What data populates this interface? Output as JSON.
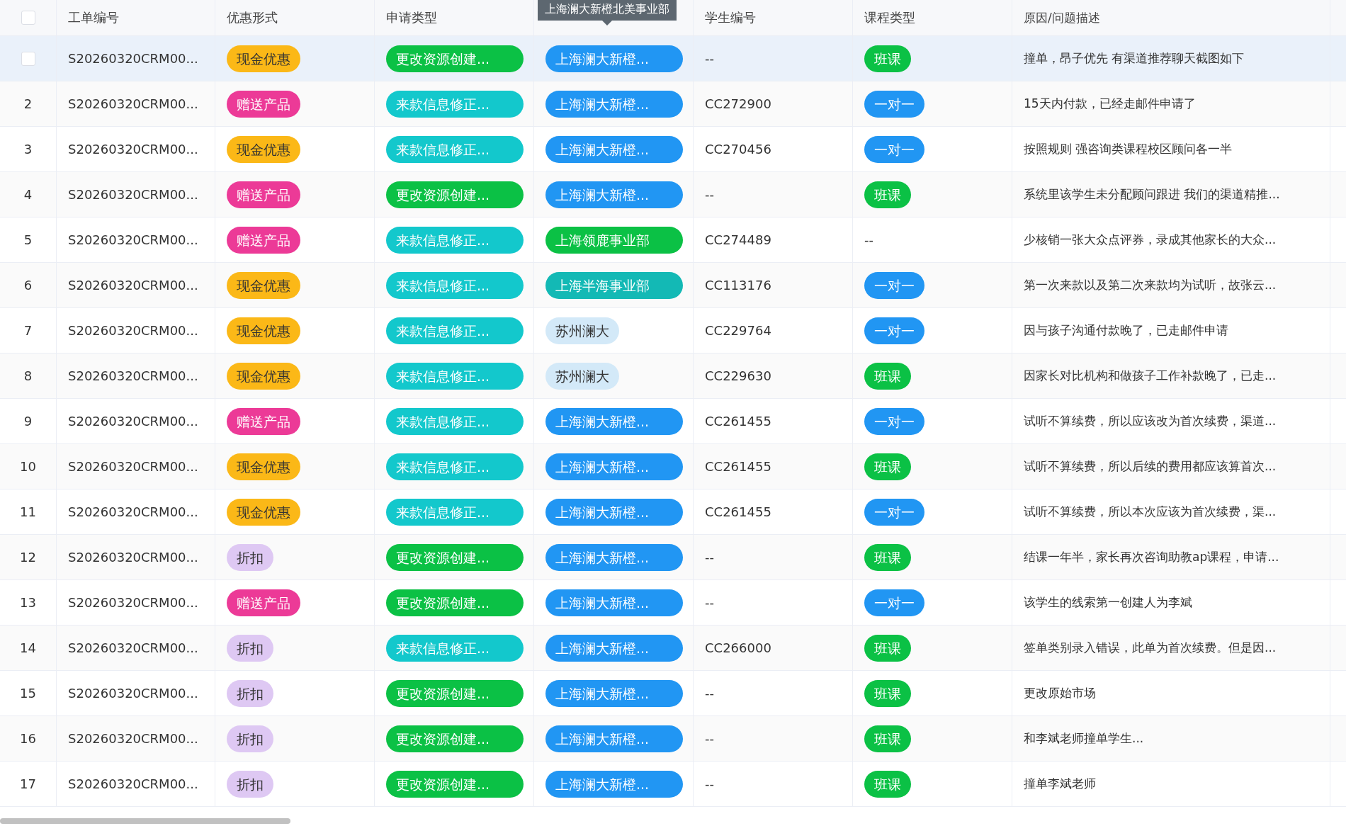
{
  "table": {
    "header_checkbox": {
      "checked": false
    },
    "columns": [
      "工单编号",
      "优惠形式",
      "申请类型",
      "",
      "学生编号",
      "课程类型",
      "原因/问题描述"
    ],
    "rows": [
      {
        "hovered": true,
        "checkbox": {
          "checked": false
        },
        "order_no": "S20260320CRM00...",
        "discount": {
          "text": "现金优惠",
          "color": "#fbb817"
        },
        "request": {
          "text": "更改资源创建...",
          "color": "#0bc145"
        },
        "org": {
          "text": "上海澜大新橙...",
          "color": "#2196f3",
          "tooltip": "上海澜大新橙北美事业部"
        },
        "student_no": "--",
        "course": {
          "text": "班课",
          "color": "#0bc145"
        },
        "reason": "撞单，昂子优先 有渠道推荐聊天截图如下"
      },
      {
        "hovered": false,
        "number": "2",
        "order_no": "S20260320CRM00...",
        "discount": {
          "text": "赠送产品",
          "color": "#ec3a97"
        },
        "request": {
          "text": "来款信息修正...",
          "color": "#13c8cc"
        },
        "org": {
          "text": "上海澜大新橙...",
          "color": "#2196f3"
        },
        "student_no": "CC272900",
        "course": {
          "text": "一对一",
          "color": "#2196f3"
        },
        "reason": "15天内付款，已经走邮件申请了"
      },
      {
        "hovered": false,
        "number": "3",
        "order_no": "S20260320CRM00...",
        "discount": {
          "text": "现金优惠",
          "color": "#fbb817"
        },
        "request": {
          "text": "来款信息修正...",
          "color": "#13c8cc"
        },
        "org": {
          "text": "上海澜大新橙...",
          "color": "#2196f3"
        },
        "student_no": "CC270456",
        "course": {
          "text": "一对一",
          "color": "#2196f3"
        },
        "reason": "按照规则 强咨询类课程校区顾问各一半"
      },
      {
        "hovered": false,
        "number": "4",
        "order_no": "S20260320CRM00...",
        "discount": {
          "text": "赠送产品",
          "color": "#ec3a97"
        },
        "request": {
          "text": "更改资源创建...",
          "color": "#0bc145"
        },
        "org": {
          "text": "上海澜大新橙...",
          "color": "#2196f3"
        },
        "student_no": "--",
        "course": {
          "text": "班课",
          "color": "#0bc145"
        },
        "reason": "系统里该学生未分配顾问跟进 我们的渠道精推..."
      },
      {
        "hovered": false,
        "number": "5",
        "order_no": "S20260320CRM00...",
        "discount": {
          "text": "赠送产品",
          "color": "#ec3a97"
        },
        "request": {
          "text": "来款信息修正...",
          "color": "#13c8cc"
        },
        "org": {
          "text": "上海领鹿事业部",
          "color": "#0bc145"
        },
        "student_no": "CC274489",
        "course_empty": "--",
        "reason": "少核销一张大众点评券，录成其他家长的大众..."
      },
      {
        "hovered": false,
        "number": "6",
        "order_no": "S20260320CRM00...",
        "discount": {
          "text": "现金优惠",
          "color": "#fbb817"
        },
        "request": {
          "text": "来款信息修正...",
          "color": "#13c8cc"
        },
        "org": {
          "text": "上海半海事业部",
          "color": "#13b9b5"
        },
        "student_no": "CC113176",
        "course": {
          "text": "一对一",
          "color": "#2196f3"
        },
        "reason": "第一次来款以及第二次来款均为试听，故张云..."
      },
      {
        "hovered": false,
        "number": "7",
        "order_no": "S20260320CRM00...",
        "discount": {
          "text": "现金优惠",
          "color": "#fbb817"
        },
        "request": {
          "text": "来款信息修正...",
          "color": "#13c8cc"
        },
        "org": {
          "text": "苏州澜大",
          "color": "#d3e9f8"
        },
        "student_no": "CC229764",
        "course": {
          "text": "一对一",
          "color": "#2196f3"
        },
        "reason": "因与孩子沟通付款晚了，已走邮件申请"
      },
      {
        "hovered": false,
        "number": "8",
        "order_no": "S20260320CRM00...",
        "discount": {
          "text": "现金优惠",
          "color": "#fbb817"
        },
        "request": {
          "text": "来款信息修正...",
          "color": "#13c8cc"
        },
        "org": {
          "text": "苏州澜大",
          "color": "#d3e9f8"
        },
        "student_no": "CC229630",
        "course": {
          "text": "班课",
          "color": "#0bc145"
        },
        "reason": "因家长对比机构和做孩子工作补款晚了，已走..."
      },
      {
        "hovered": false,
        "number": "9",
        "order_no": "S20260320CRM00...",
        "discount": {
          "text": "赠送产品",
          "color": "#ec3a97"
        },
        "request": {
          "text": "来款信息修正...",
          "color": "#13c8cc"
        },
        "org": {
          "text": "上海澜大新橙...",
          "color": "#2196f3"
        },
        "student_no": "CC261455",
        "course": {
          "text": "一对一",
          "color": "#2196f3"
        },
        "reason": "试听不算续费，所以应该改为首次续费，渠道..."
      },
      {
        "hovered": false,
        "number": "10",
        "order_no": "S20260320CRM00...",
        "discount": {
          "text": "现金优惠",
          "color": "#fbb817"
        },
        "request": {
          "text": "来款信息修正...",
          "color": "#13c8cc"
        },
        "org": {
          "text": "上海澜大新橙...",
          "color": "#2196f3"
        },
        "student_no": "CC261455",
        "course": {
          "text": "班课",
          "color": "#0bc145"
        },
        "reason": "试听不算续费，所以后续的费用都应该算首次..."
      },
      {
        "hovered": false,
        "number": "11",
        "order_no": "S20260320CRM00...",
        "discount": {
          "text": "现金优惠",
          "color": "#fbb817"
        },
        "request": {
          "text": "来款信息修正...",
          "color": "#13c8cc"
        },
        "org": {
          "text": "上海澜大新橙...",
          "color": "#2196f3"
        },
        "student_no": "CC261455",
        "course": {
          "text": "一对一",
          "color": "#2196f3"
        },
        "reason": "试听不算续费，所以本次应该为首次续费，渠..."
      },
      {
        "hovered": false,
        "number": "12",
        "order_no": "S20260320CRM00...",
        "discount": {
          "text": "折扣",
          "color": "#dec8f3"
        },
        "request": {
          "text": "更改资源创建...",
          "color": "#0bc145"
        },
        "org": {
          "text": "上海澜大新橙...",
          "color": "#2196f3"
        },
        "student_no": "--",
        "course": {
          "text": "班课",
          "color": "#0bc145"
        },
        "reason": "结课一年半，家长再次咨询助教ap课程，申请..."
      },
      {
        "hovered": false,
        "number": "13",
        "order_no": "S20260320CRM00...",
        "discount": {
          "text": "赠送产品",
          "color": "#ec3a97"
        },
        "request": {
          "text": "更改资源创建...",
          "color": "#0bc145"
        },
        "org": {
          "text": "上海澜大新橙...",
          "color": "#2196f3"
        },
        "student_no": "--",
        "course": {
          "text": "一对一",
          "color": "#2196f3"
        },
        "reason": "该学生的线索第一创建人为李斌"
      },
      {
        "hovered": false,
        "number": "14",
        "order_no": "S20260320CRM00...",
        "discount": {
          "text": "折扣",
          "color": "#dec8f3"
        },
        "request": {
          "text": "来款信息修正...",
          "color": "#13c8cc"
        },
        "org": {
          "text": "上海澜大新橙...",
          "color": "#2196f3"
        },
        "student_no": "CC266000",
        "course": {
          "text": "班课",
          "color": "#0bc145"
        },
        "reason": "签单类别录入错误，此单为首次续费。但是因..."
      },
      {
        "hovered": false,
        "number": "15",
        "order_no": "S20260320CRM00...",
        "discount": {
          "text": "折扣",
          "color": "#dec8f3"
        },
        "request": {
          "text": "更改资源创建...",
          "color": "#0bc145"
        },
        "org": {
          "text": "上海澜大新橙...",
          "color": "#2196f3"
        },
        "student_no": "--",
        "course": {
          "text": "班课",
          "color": "#0bc145"
        },
        "reason": "更改原始市场"
      },
      {
        "hovered": false,
        "number": "16",
        "order_no": "S20260320CRM00...",
        "discount": {
          "text": "折扣",
          "color": "#dec8f3"
        },
        "request": {
          "text": "更改资源创建...",
          "color": "#0bc145"
        },
        "org": {
          "text": "上海澜大新橙...",
          "color": "#2196f3"
        },
        "student_no": "--",
        "course": {
          "text": "班课",
          "color": "#0bc145"
        },
        "reason": "和李斌老师撞单学生..."
      },
      {
        "hovered": false,
        "number": "17",
        "order_no": "S20260320CRM00...",
        "discount": {
          "text": "折扣",
          "color": "#dec8f3"
        },
        "request": {
          "text": "更改资源创建...",
          "color": "#0bc145"
        },
        "org": {
          "text": "上海澜大新橙...",
          "color": "#2196f3"
        },
        "student_no": "--",
        "course": {
          "text": "班课",
          "color": "#0bc145"
        },
        "reason": "撞单李斌老师"
      }
    ]
  }
}
